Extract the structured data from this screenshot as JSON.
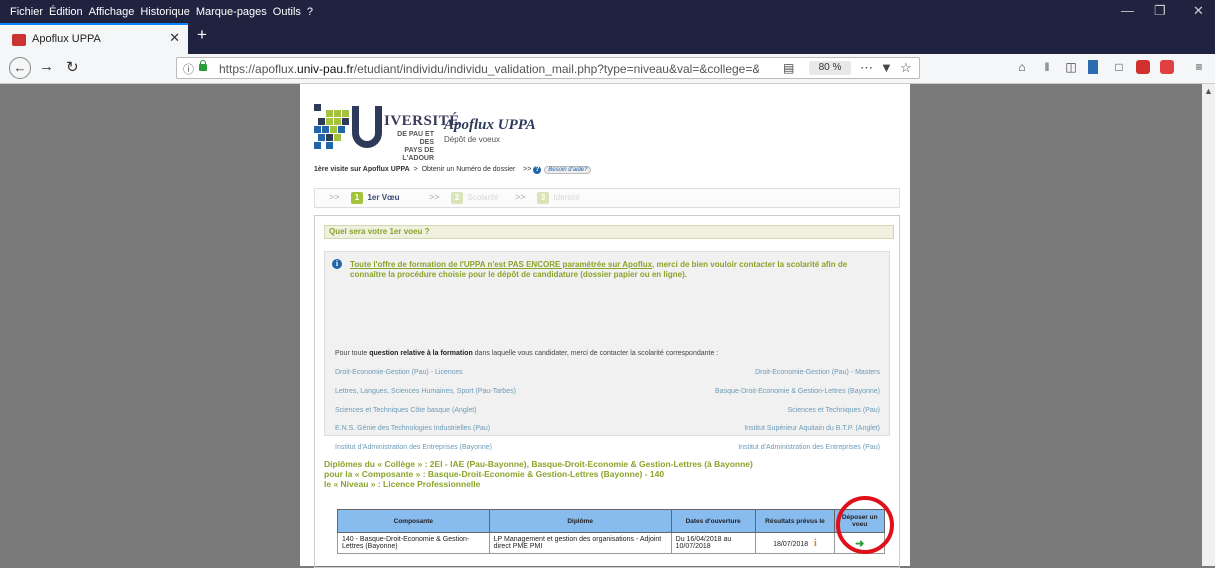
{
  "menubar": {
    "items": [
      "Fichier",
      "Édition",
      "Affichage",
      "Historique",
      "Marque-pages",
      "Outils",
      "?"
    ]
  },
  "tab": {
    "title": "Apoflux UPPA"
  },
  "urlbar": {
    "url_prefix": "https://apoflux.",
    "url_domain": "univ-pau.fr",
    "url_suffix": "/etudiant/individu/individu_validation_mail.php?type=niveau&val=&college=&comp",
    "zoom": "80 %"
  },
  "header": {
    "univ_name": "IVERSITÉ",
    "univ_sub1": "DE PAU ET DES",
    "univ_sub2": "PAYS DE L'ADOUR",
    "app_title": "Apoflux UPPA",
    "app_subtitle": "Dépôt de voeux"
  },
  "breadcrumb": {
    "first": "1ère visite sur Apoflux UPPA",
    "sep": ">",
    "second": "Obtenir un Numéro de dossier",
    "arrows": ">>",
    "help": "Besoin d'aide?"
  },
  "steps": [
    {
      "num": "1",
      "label": "1er Vœu"
    },
    {
      "num": "2",
      "label": "Scolarité"
    },
    {
      "num": "3",
      "label": "Identité"
    }
  ],
  "question": "Quel sera votre 1er voeu ?",
  "notice": {
    "underlined": "Toute l'offre de formation de l'UPPA n'est PAS ENCORE paramétrée sur Apoflux",
    "rest": ", merci de bien vouloir contacter la scolarité afin de connaître la procédure choisie pour le dépôt de candidature (dossier papier ou en ligne)."
  },
  "contact": {
    "intro_before": "Pour toute ",
    "intro_bold": "question relative à la formation",
    "intro_after": " dans laquelle vous candidater, merci de contacter la scolarité correspondante :",
    "left_links": [
      "Droit-Economie-Gestion (Pau) - Licences",
      "Lettres, Langues, Sciences Humaines, Sport (Pau-Tarbes)",
      "Sciences et Techniques Côte basque (Anglet)",
      "E.N.S. Génie des Technologies Industrielles (Pau)",
      "Institut d'Administration des Entreprises (Bayonne)"
    ],
    "right_links": [
      "Droit-Economie-Gestion (Pau) - Masters",
      "Basque-Droit-Economie & Gestion-Lettres (Bayonne)",
      "Sciences et Techniques (Pau)",
      "Institut Supérieur Aquitain du B.T.P. (Anglet)",
      "Institut d'Administration des Entreprises (Pau)"
    ]
  },
  "diplomas": {
    "line1": "Diplômes du « Collège » : 2EI - IAE (Pau-Bayonne), Basque-Droit-Economie & Gestion-Lettres (à Bayonne)",
    "line2": "pour la « Composante » : Basque-Droit-Economie & Gestion-Lettres (Bayonne) - 140",
    "line3": "le « Niveau » : Licence Professionnelle"
  },
  "table": {
    "headers": [
      "Composante",
      "Diplôme",
      "Dates d'ouverture",
      "Résultats prévus le",
      "Déposer un voeu"
    ],
    "row": {
      "composante": "140 - Basque-Droit-Economie & Gestion-Lettres (Bayonne)",
      "diplome": "LP Management et gestion des organisations - Adjoint direct PME PMI",
      "dates": "Du 16/04/2018 au 10/07/2018",
      "resultats": "18/07/2018",
      "info": "i",
      "arrow": "➜"
    }
  },
  "colors": {
    "accent_green": "#8aa42a",
    "header_blue": "#88bbee",
    "annotation_red": "#e0101a"
  }
}
